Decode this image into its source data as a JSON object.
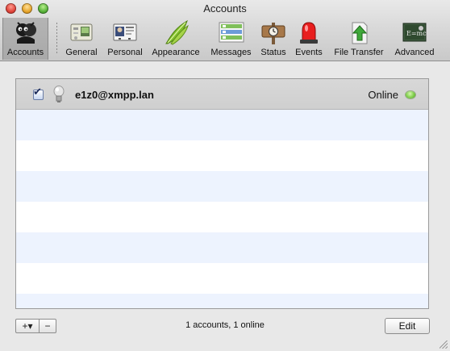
{
  "window": {
    "title": "Accounts"
  },
  "toolbar": {
    "items": [
      {
        "label": "Accounts",
        "icon": "accounts-icon",
        "selected": true
      },
      {
        "label": "General",
        "icon": "general-icon"
      },
      {
        "label": "Personal",
        "icon": "personal-icon"
      },
      {
        "label": "Appearance",
        "icon": "appearance-icon"
      },
      {
        "label": "Messages",
        "icon": "messages-icon"
      },
      {
        "label": "Status",
        "icon": "status-icon"
      },
      {
        "label": "Events",
        "icon": "events-icon"
      },
      {
        "label": "File Transfer",
        "icon": "file-transfer-icon"
      },
      {
        "label": "Advanced",
        "icon": "advanced-icon"
      }
    ]
  },
  "accounts": [
    {
      "name": "e1z0@xmpp.lan",
      "enabled": true,
      "status": "Online",
      "status_color": "#7fcf4b"
    }
  ],
  "footer": {
    "add_label": "+▾",
    "remove_label": "−",
    "summary": "1 accounts, 1 online",
    "edit_label": "Edit"
  },
  "colors": {
    "stripe": "#edf3fe",
    "selected_row": "#d3d3d3"
  }
}
